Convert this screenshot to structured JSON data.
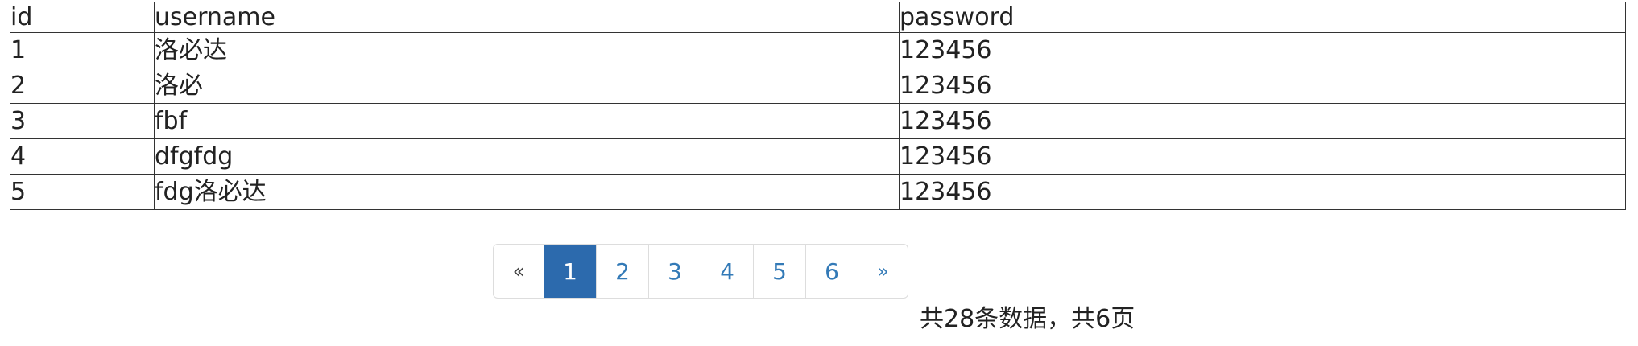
{
  "table": {
    "headers": [
      "id",
      "username",
      "password"
    ],
    "rows": [
      [
        "1",
        "洛必达",
        "123456"
      ],
      [
        "2",
        "洛必",
        "123456"
      ],
      [
        "3",
        "fbf",
        "123456"
      ],
      [
        "4",
        "dfgfdg",
        "123456"
      ],
      [
        "5",
        "fdg洛必达",
        "123456"
      ]
    ]
  },
  "pagination": {
    "prev_label": "«",
    "pages": [
      "1",
      "2",
      "3",
      "4",
      "5",
      "6"
    ],
    "active_page": "1",
    "next_label": "»"
  },
  "summary": "共28条数据，共6页",
  "colors": {
    "active_bg": "#2c6aad",
    "link": "#337ab7",
    "border": "#333333"
  }
}
